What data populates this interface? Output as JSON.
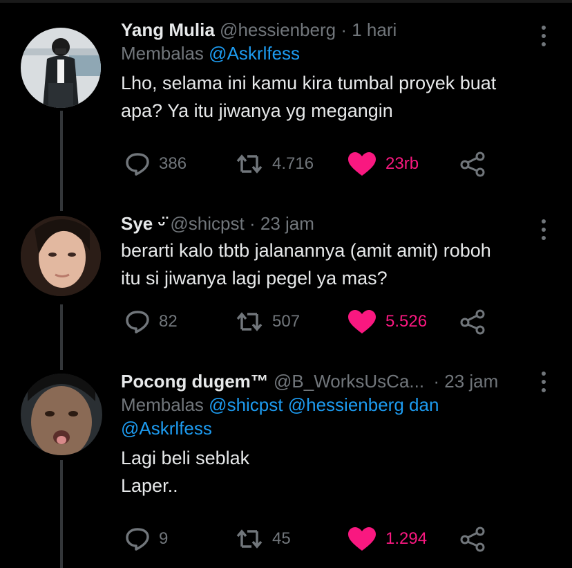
{
  "tweets": [
    {
      "name": "Yang Mulia",
      "handle": "@hessienberg",
      "time": "1 hari",
      "replying_prefix": "Membalas",
      "replying_to": [
        "@Askrlfess"
      ],
      "replying_joiner": "",
      "text_lines": [
        "Lho, selama ini kamu kira tumbal proyek buat",
        "apa? Ya itu jiwanya yg megangin"
      ],
      "replies": "386",
      "retweets": "4.716",
      "likes": "23rb"
    },
    {
      "name": "Sye ᵕ̈",
      "handle": "@shicpst",
      "time": "23 jam",
      "text_lines": [
        "berarti kalo tbtb jalanannya (amit amit) roboh",
        "itu si jiwanya lagi pegel ya mas?"
      ],
      "replies": "82",
      "retweets": "507",
      "likes": "5.526"
    },
    {
      "name": "Pocong dugem™",
      "handle": "@B_WorksUsCa...",
      "time": "23 jam",
      "replying_prefix": "Membalas",
      "replying_to": [
        "@shicpst",
        "@hessienberg",
        "@Askrlfess"
      ],
      "replying_joiner": "dan",
      "text_lines": [
        "Lagi beli seblak",
        "Laper.."
      ],
      "replies": "9",
      "retweets": "45",
      "likes": "1.294"
    }
  ],
  "icons": {
    "reply": "reply-icon",
    "retweet": "retweet-icon",
    "like": "heart-icon",
    "share": "share-icon",
    "more": "more-options-icon"
  },
  "colors": {
    "background": "#000000",
    "text": "#e7e9ea",
    "secondary": "#71767b",
    "mention": "#1d9bf0",
    "like": "#f91880"
  }
}
